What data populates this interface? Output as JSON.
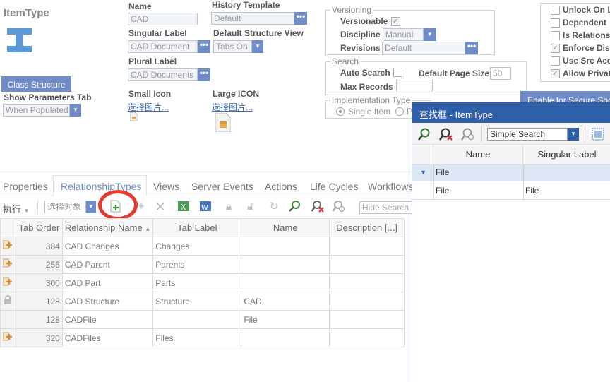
{
  "header": {
    "title": "ItemType",
    "class_structure_btn": "Class Structure",
    "show_params_label": "Show Parameters Tab",
    "show_params_value": "When Populated"
  },
  "form": {
    "name_label": "Name",
    "name_value": "CAD",
    "singular_label": "Singular Label",
    "singular_value": "CAD Document",
    "plural_label": "Plural Label",
    "plural_value": "CAD Documents",
    "small_icon_label": "Small Icon",
    "large_icon_label": "Large ICON",
    "select_image_link": "选择图片...",
    "history_template_label": "History Template",
    "history_template_value": "Default",
    "default_structure_view_label": "Default Structure View",
    "default_structure_view_value": "Tabs On",
    "dots": "•••"
  },
  "versioning": {
    "title": "Versioning",
    "versionable_label": "Versionable",
    "discipline_label": "Discipline",
    "discipline_value": "Manual",
    "revisions_label": "Revisions",
    "revisions_value": "Default"
  },
  "search": {
    "title": "Search",
    "auto_search_label": "Auto Search",
    "default_page_size_label": "Default Page Size",
    "default_page_size_value": "50",
    "max_records_label": "Max Records"
  },
  "implementation": {
    "title": "Implementation Type",
    "single_item": "Single Item",
    "p_option": "P"
  },
  "right_options": {
    "items": [
      {
        "label": "Unlock On L",
        "checked": false
      },
      {
        "label": "Dependent",
        "checked": false
      },
      {
        "label": "Is Relations",
        "checked": false
      },
      {
        "label": "Enforce Dis",
        "checked": true
      },
      {
        "label": "Use Src Acc",
        "checked": false
      },
      {
        "label": "Allow Privat",
        "checked": true
      }
    ],
    "secure_btn": "Enable for Secure Soc"
  },
  "tabs": [
    "Properties",
    "RelationshipTypes",
    "Views",
    "Server Events",
    "Actions",
    "Life Cycles",
    "Workflows"
  ],
  "toolbar": {
    "execute": "执行",
    "select_object": "选择对象",
    "hide_search": "Hide Search"
  },
  "grid": {
    "headers": [
      "Tab Order",
      "Relationship Name",
      "Tab Label",
      "Name",
      "Description [...]"
    ],
    "rows": [
      {
        "icon": "add-icon",
        "order": "384",
        "rel": "CAD Changes",
        "tab": "Changes",
        "name": "",
        "desc": ""
      },
      {
        "icon": "add-icon",
        "order": "256",
        "rel": "CAD Parent",
        "tab": "Parents",
        "name": "",
        "desc": ""
      },
      {
        "icon": "add-icon",
        "order": "300",
        "rel": "CAD Part",
        "tab": "Parts",
        "name": "",
        "desc": ""
      },
      {
        "icon": "lock-icon",
        "order": "128",
        "rel": "CAD Structure",
        "tab": "Structure",
        "name": "CAD",
        "desc": ""
      },
      {
        "icon": "",
        "order": "128",
        "rel": "CADFile",
        "tab": "",
        "name": "File",
        "desc": ""
      },
      {
        "icon": "add-icon",
        "order": "320",
        "rel": "CADFiles",
        "tab": "Files",
        "name": "",
        "desc": ""
      }
    ]
  },
  "dialog": {
    "title": "查找框 - ItemType",
    "search_mode": "Simple Search",
    "col_name": "Name",
    "col_singular": "Singular Label",
    "group_label": "File",
    "row_name": "File",
    "row_singular": "File"
  },
  "colors": {
    "accent": "#6f8cc8",
    "dialog_title_bg": "#2e5fa8",
    "annotation": "#e53a2e"
  }
}
